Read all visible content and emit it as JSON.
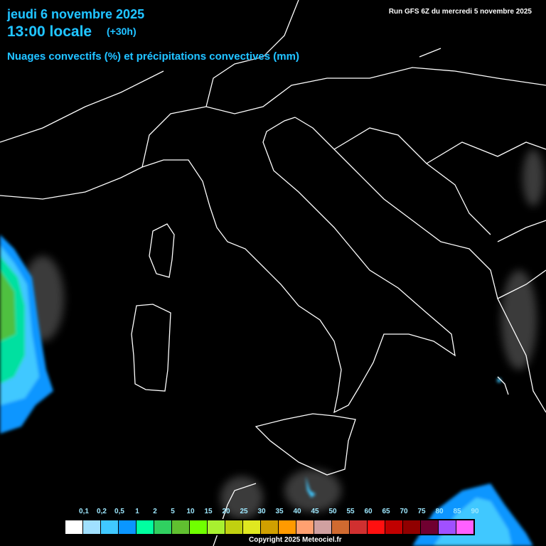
{
  "header": {
    "date": "jeudi 6 novembre 2025",
    "time": "13:00 locale",
    "offset": "(+30h)",
    "subtitle": "Nuages convectifs (%) et précipitations convectives (mm)",
    "run": "Run GFS 6Z du mercredi 5 novembre 2025"
  },
  "legend": {
    "labels": [
      "0,1",
      "0,2",
      "0,5",
      "1",
      "2",
      "5",
      "10",
      "15",
      "20",
      "25",
      "30",
      "35",
      "40",
      "45",
      "50",
      "55",
      "60",
      "65",
      "70",
      "75",
      "80",
      "85",
      "90"
    ],
    "colors": [
      "#ffffff",
      "#a0e0ff",
      "#40c8ff",
      "#0a96ff",
      "#00ffa0",
      "#30d060",
      "#60c030",
      "#70ff00",
      "#a8f030",
      "#c0d010",
      "#e0e820",
      "#d0a000",
      "#ff9a00",
      "#ffa070",
      "#d0a0a0",
      "#d06a30",
      "#d03030",
      "#ff1010",
      "#c00000",
      "#900000",
      "#700030",
      "#a050ff",
      "#ff60ff"
    ]
  },
  "footer": {
    "copyright": "Copyright 2025 Meteociel.fr"
  }
}
